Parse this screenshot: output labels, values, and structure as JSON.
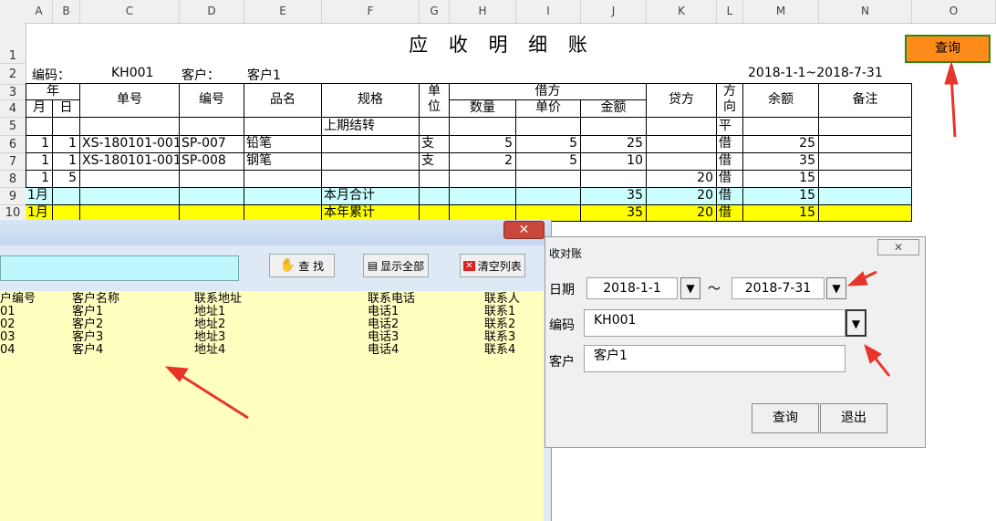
{
  "sheet": {
    "columns": [
      "A",
      "B",
      "C",
      "D",
      "E",
      "F",
      "G",
      "H",
      "I",
      "J",
      "K",
      "L",
      "M",
      "N",
      "O"
    ],
    "rows": [
      "1",
      "2",
      "3",
      "4",
      "5",
      "6",
      "7",
      "8",
      "9",
      "10"
    ],
    "title": "应 收 明 细 账",
    "code_label": "编码：",
    "code_value": "KH001",
    "customer_label": "客户：",
    "customer_value": "客户1",
    "date_range": "2018-1-1~2018-7-31",
    "query_button": "查询",
    "headers": {
      "year": "年",
      "month": "月",
      "day": "日",
      "doc_no": "单号",
      "item_code": "编号",
      "item_name": "品名",
      "spec": "规格",
      "unit": "单\n位",
      "debit": "借方",
      "qty": "数量",
      "price": "单价",
      "amount": "金额",
      "credit": "贷方",
      "direction": "方\n向",
      "balance": "余额",
      "remark": "备注"
    },
    "data_rows": [
      {
        "month": "",
        "day": "",
        "doc": "",
        "code": "",
        "name": "",
        "spec": "上期结转",
        "unit": "",
        "qty": "",
        "price": "",
        "amount": "",
        "credit": "",
        "dir": "平",
        "bal": "",
        "remark": ""
      },
      {
        "month": "1",
        "day": "1",
        "doc": "XS-180101-001",
        "code": "SP-007",
        "name": "铅笔",
        "spec": "",
        "unit": "支",
        "qty": "5",
        "price": "5",
        "amount": "25",
        "credit": "",
        "dir": "借",
        "bal": "25",
        "remark": ""
      },
      {
        "month": "1",
        "day": "1",
        "doc": "XS-180101-001",
        "code": "SP-008",
        "name": "钢笔",
        "spec": "",
        "unit": "支",
        "qty": "2",
        "price": "5",
        "amount": "10",
        "credit": "",
        "dir": "借",
        "bal": "35",
        "remark": ""
      },
      {
        "month": "1",
        "day": "5",
        "doc": "",
        "code": "",
        "name": "",
        "spec": "",
        "unit": "",
        "qty": "",
        "price": "",
        "amount": "",
        "credit": "20",
        "dir": "借",
        "bal": "15",
        "remark": ""
      },
      {
        "month": "1月",
        "day": "",
        "doc": "",
        "code": "",
        "name": "",
        "spec": "本月合计",
        "unit": "",
        "qty": "",
        "price": "",
        "amount": "35",
        "credit": "20",
        "dir": "借",
        "bal": "15",
        "remark": ""
      },
      {
        "month": "1月",
        "day": "",
        "doc": "",
        "code": "",
        "name": "",
        "spec": "本年累计",
        "unit": "",
        "qty": "",
        "price": "",
        "amount": "35",
        "credit": "20",
        "dir": "借",
        "bal": "15",
        "remark": ""
      }
    ],
    "colors": {
      "month_total": "#ccffff",
      "year_total": "#ffff00",
      "query_btn": "#ff8c1a"
    }
  },
  "customer_dialog": {
    "close_glyph": "✕",
    "find_button": "查  找",
    "show_all_button": "显示全部",
    "clear_button": "清空列表",
    "columns": [
      "户编号",
      "客户名称",
      "联系地址",
      "联系电话",
      "联系人"
    ],
    "rows": [
      [
        "01",
        "客户1",
        "地址1",
        "电话1",
        "联系1"
      ],
      [
        "02",
        "客户2",
        "地址2",
        "电话2",
        "联系2"
      ],
      [
        "03",
        "客户3",
        "地址3",
        "电话3",
        "联系3"
      ],
      [
        "04",
        "客户4",
        "地址4",
        "电话4",
        "联系4"
      ]
    ]
  },
  "recon_dialog": {
    "title": "收对账",
    "close_glyph": "✕",
    "date_label": "日期",
    "date_from": "2018-1-1",
    "date_sep": "～",
    "date_to": "2018-7-31",
    "code_label": "编码",
    "code_value": "KH001",
    "customer_label": "客户",
    "customer_value": "客户1",
    "query_button": "查询",
    "exit_button": "退出"
  }
}
